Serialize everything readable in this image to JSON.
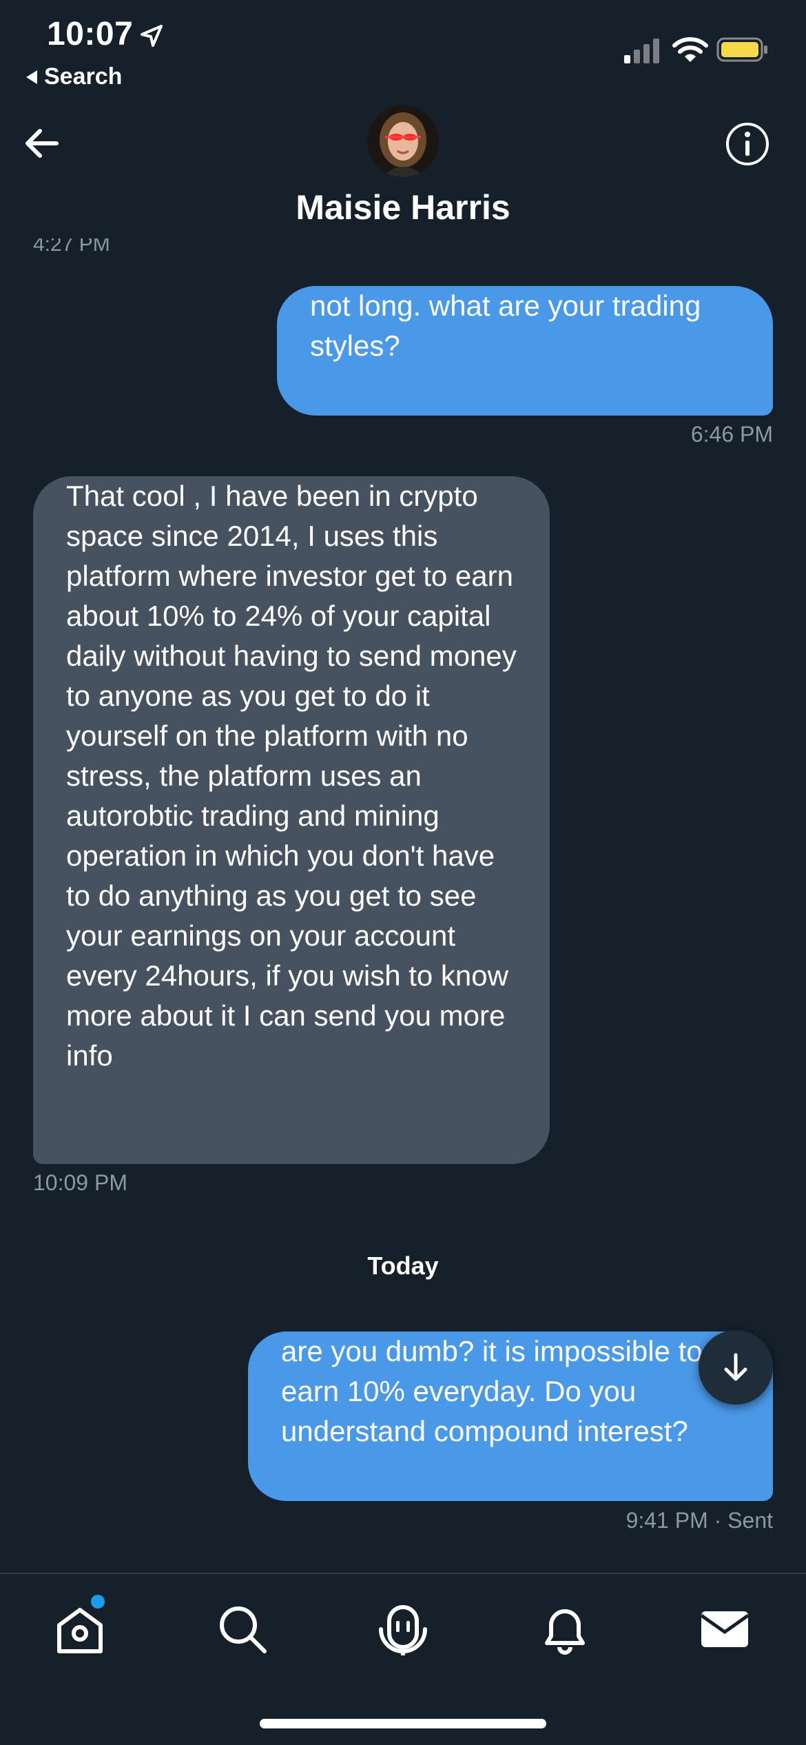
{
  "status_bar": {
    "time": "10:07",
    "back_app_label": "Search"
  },
  "header": {
    "contact_name": "Maisie Harris"
  },
  "conversation": {
    "partial_timestamp": "4:27 PM",
    "messages": [
      {
        "direction": "outgoing",
        "text": "not long. what are your trading styles?",
        "timestamp": "6:46 PM"
      },
      {
        "direction": "incoming",
        "text": "That cool , I have been in crypto space since 2014, I uses this platform where investor get to earn about 10% to 24% of your capital daily without having to send money to anyone as you get to do it yourself on the platform with no stress, the platform uses an autorobtic trading and mining operation in which you don't have to do anything as you get to see your earnings on your account every 24hours,  if you wish to know more about it I can send you more info",
        "timestamp": "10:09 PM"
      },
      {
        "direction": "outgoing",
        "text": "are you dumb? it is impossible to earn 10% everyday. Do you understand compound interest?",
        "timestamp": "9:41 PM · Sent"
      }
    ],
    "day_separator": "Today"
  },
  "tabbar": {
    "items": [
      "home-icon",
      "search-icon",
      "spaces-icon",
      "notifications-icon",
      "messages-icon"
    ]
  },
  "colors": {
    "background": "#15202b",
    "outgoing_bubble": "#4a99e9",
    "incoming_bubble": "#46525f",
    "timestamp": "#8b98a5",
    "battery": "#f5d94a",
    "notification_dot": "#1d9bf0"
  }
}
